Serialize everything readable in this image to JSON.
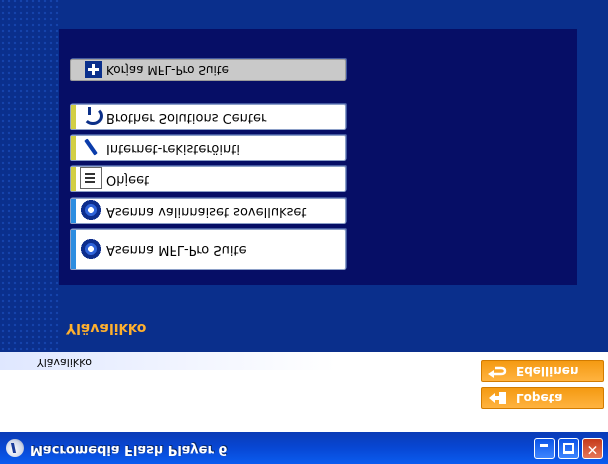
{
  "window": {
    "title": "Macromedia Flash Player 6",
    "controls": {
      "minimize": "minimize-icon",
      "maximize": "maximize-icon",
      "close": "close-icon"
    }
  },
  "side_buttons": {
    "back_label": "Edellinen",
    "quit_label": "Lopeta"
  },
  "caption": "Ylävalikko",
  "heading": "Ylävalikko",
  "menu": {
    "items": [
      {
        "label": "Asenna MFL-Pro Suite",
        "icon": "cd-icon"
      },
      {
        "label": "Asenna valinnaiset sovellukset",
        "icon": "cd-icon"
      },
      {
        "label": "Ohjeet",
        "icon": "document-icon"
      },
      {
        "label": "Internet-rekisteröinti",
        "icon": "pen-icon"
      },
      {
        "label": "Brother Solutions Center",
        "icon": "phone-icon"
      },
      {
        "label": "Korjaa MFL-Pro Suite",
        "icon": "plus-icon"
      }
    ]
  },
  "colors": {
    "background": "#0a2f8c",
    "panel": "#060e66",
    "accent_orange": "#f49a12",
    "heading": "#ffb02e"
  }
}
